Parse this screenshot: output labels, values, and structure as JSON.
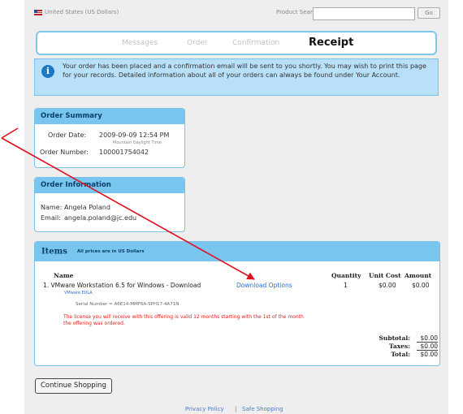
{
  "topbar": {
    "region": "United States (US Dollars)",
    "product_search_label": "Product Search",
    "search_value": "",
    "go_label": "Go"
  },
  "steps": [
    "Messages",
    "Order",
    "Confirmation",
    "Receipt"
  ],
  "info_message": "Your order has been placed and a confirmation email will be sent to you shortly. You may wish to print this page for your records. Detailed information about all of your orders can always be found under Your Account.",
  "order_summary": {
    "title": "Order Summary",
    "order_date_label": "Order Date:",
    "order_date": "2009-09-09 12:54 PM",
    "timezone": "Mountain Daylight Time",
    "order_number_label": "Order Number:",
    "order_number": "100001754042"
  },
  "order_information": {
    "title": "Order Information",
    "name_label": "Name:",
    "name": "Angela Poland",
    "email_label": "Email:",
    "email": "angela.poland@jc.edu"
  },
  "items": {
    "title": "Items",
    "note": "All prices are in US Dollars",
    "headers": {
      "name": "Name",
      "quantity": "Quantity",
      "unit_cost": "Unit Cost",
      "amount": "Amount"
    },
    "row": {
      "name": "1. VMware Workstation 6.5 for Windows - Download",
      "download_link": "Download Options",
      "eula": "VMware EULA",
      "serial": "Serial Number = A6E14-MMF6A-SPH17-4A71N",
      "license_note": "The license you will receive with this offering is valid 12 months starting with the 1st of the month the offering was ordered.",
      "quantity": "1",
      "unit_cost": "$0.00",
      "amount": "$0.00"
    },
    "totals": {
      "subtotal_label": "Subtotal:",
      "subtotal": "$0.00",
      "taxes_label": "Taxes:",
      "taxes": "$0.00",
      "total_label": "Total:",
      "total": "$0.00"
    }
  },
  "continue_label": "Continue Shopping",
  "footer": {
    "privacy": "Privacy Policy",
    "separator": "|",
    "safe": "Safe Shopping"
  },
  "colors": {
    "accent": "#78c6ee",
    "link": "#2a6fd0",
    "warning": "#e02020",
    "annotation_arrow": "#e0101a"
  }
}
